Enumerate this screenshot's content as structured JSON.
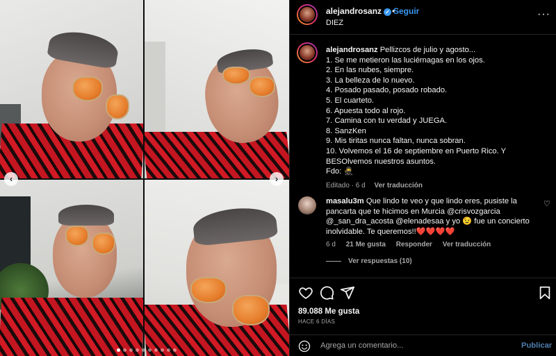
{
  "post": {
    "username": "alejandrosanz",
    "follow_label": "Seguir",
    "subtitle": "DIEZ",
    "more_label": "···"
  },
  "caption": {
    "username": "alejandrosanz",
    "lines": [
      "Pellizcos de julio y agosto...",
      "1. Se me metieron las luciérnagas en los ojos.",
      "2. En las nubes, siempre.",
      "3. La belleza de lo nuevo.",
      "4. Posado pasado, posado robado.",
      "5. El cuarteto.",
      "6. Apuesta todo al rojo.",
      "7. Camina con tu verdad y JUEGA.",
      "8. SanzKen",
      "9. Mis tiritas nunca faltan, nunca sobran.",
      "10. Volvemos el 16 de septiembre en Puerto Rico. Y BESOlvemos nuestros asuntos.",
      "Fdo: 🥷"
    ],
    "edited": "Editado · 6 d",
    "translate": "Ver traducción"
  },
  "comment": {
    "username": "masalu3m",
    "text": "Que lindo te veo y que lindo eres, pusiste la pancarta que te hicimos en Murcia @crisvozgarcia @_san_dra_acosta @elenadesaa y yo 😉 fue un concierto inolvidable. Te queremos!!❤️❤️❤️❤️",
    "time": "6 d",
    "likes": "21 Me gusta",
    "reply": "Responder",
    "translate": "Ver traducción",
    "view_replies": "Ver respuestas (10)"
  },
  "actions": {
    "likes_count": "89.088 Me gusta",
    "time_ago": "HACE 6 DÍAS"
  },
  "add_comment": {
    "placeholder": "Agrega un comentario...",
    "publish": "Publicar"
  },
  "carousel": {
    "prev": "‹",
    "next": "›",
    "dot_count": 10,
    "active_index": 0
  },
  "colors": {
    "accent": "#3897f0",
    "publish": "#4f7faf",
    "muted": "#a8a8a8"
  },
  "icons": [
    "heart-icon",
    "comment-icon",
    "share-icon",
    "bookmark-icon",
    "emoji-icon",
    "more-icon",
    "verified-icon"
  ]
}
